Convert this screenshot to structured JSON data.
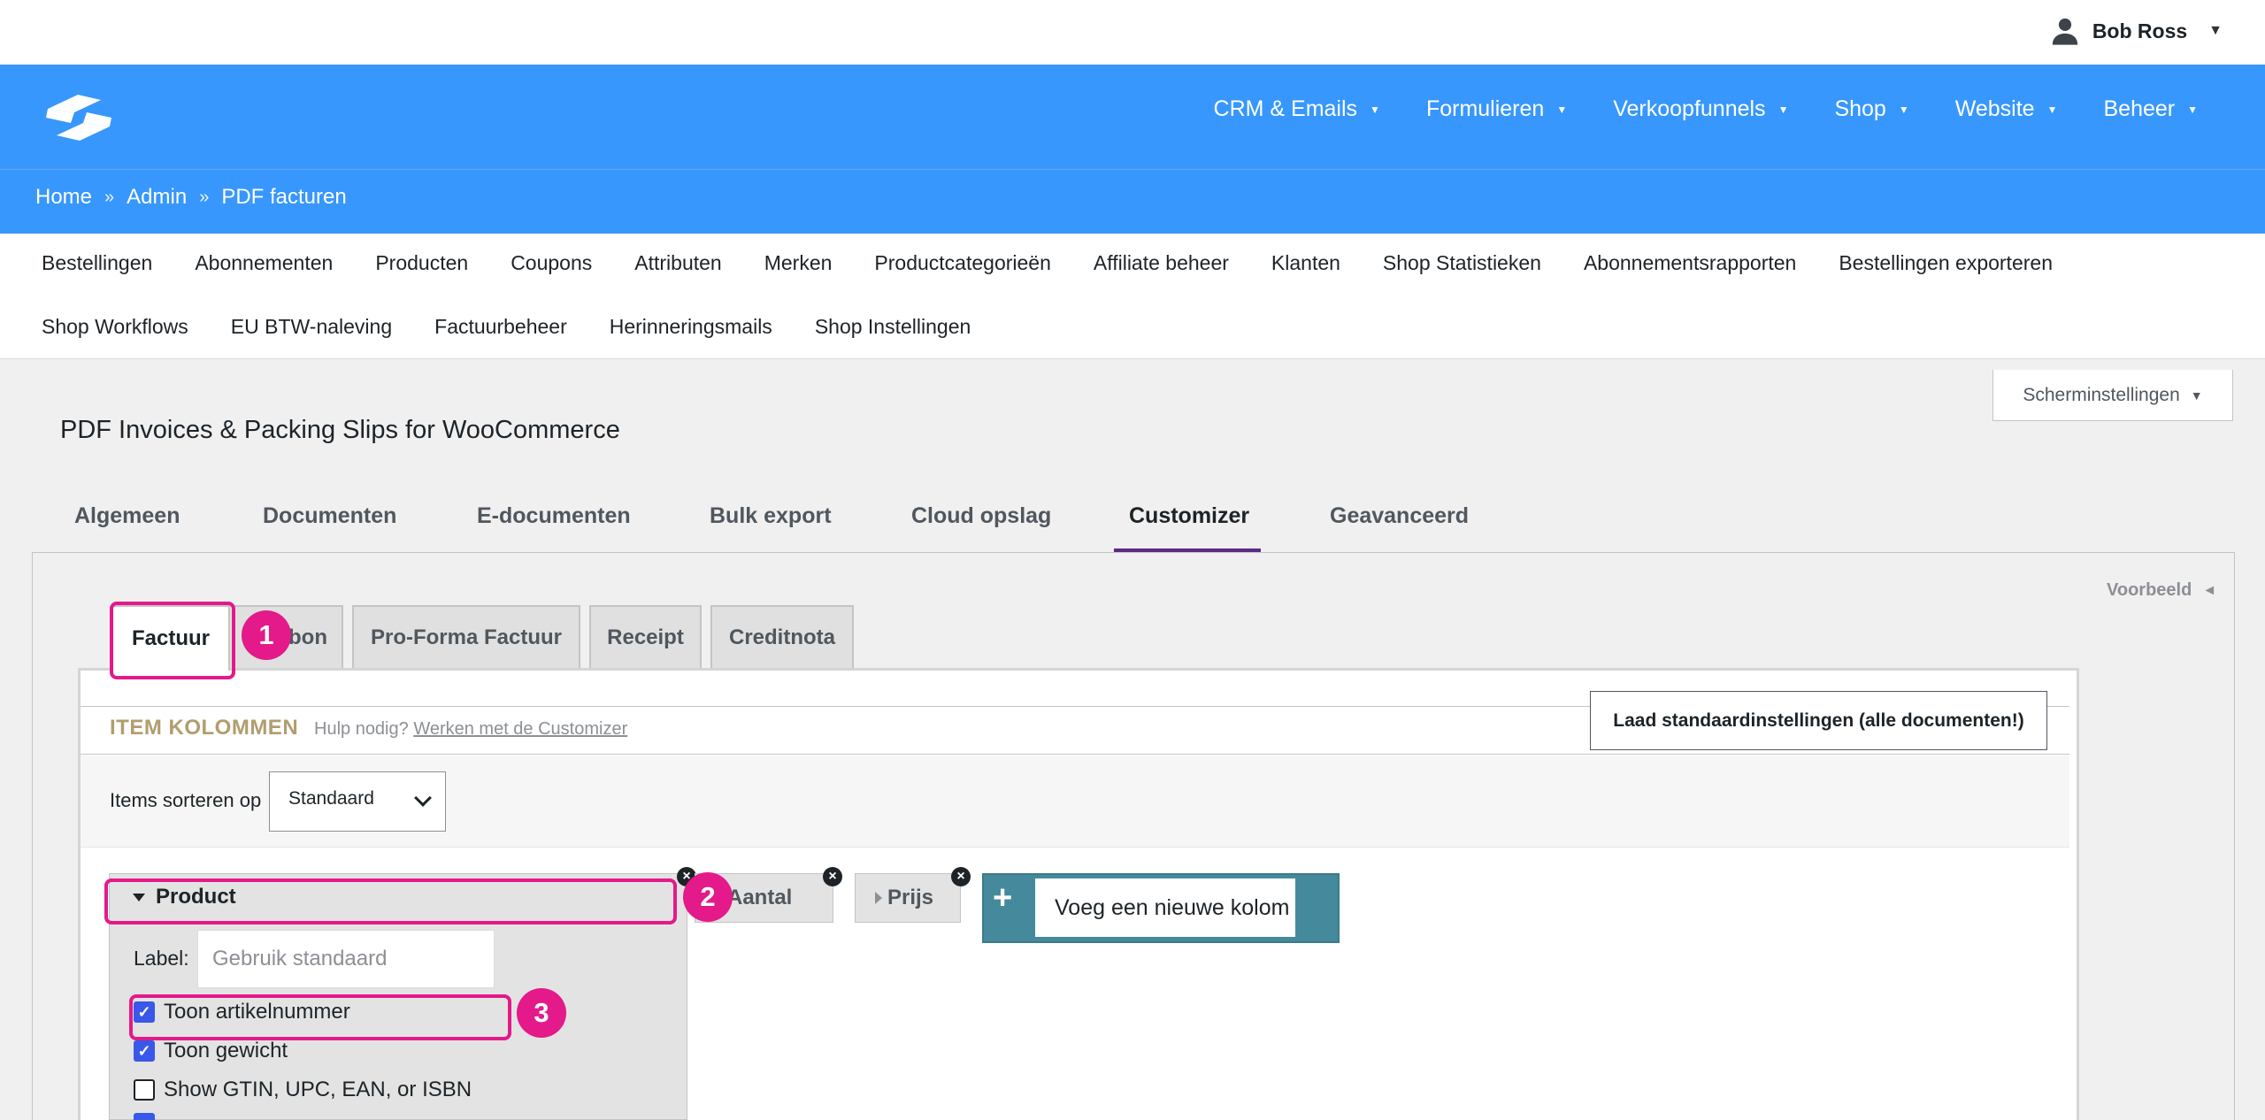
{
  "user": {
    "name": "Bob Ross",
    "icon": "user-icon"
  },
  "brand": {
    "logo": "brand-logo-icon",
    "color": "#3797fc"
  },
  "mainnav": [
    {
      "label": "CRM & Emails"
    },
    {
      "label": "Formulieren"
    },
    {
      "label": "Verkoopfunnels"
    },
    {
      "label": "Shop"
    },
    {
      "label": "Website"
    },
    {
      "label": "Beheer"
    }
  ],
  "breadcrumb": {
    "home": "Home",
    "sep": "»",
    "admin": "Admin",
    "current": "PDF facturen"
  },
  "subnav": {
    "row1": [
      "Bestellingen",
      "Abonnementen",
      "Producten",
      "Coupons",
      "Attributen",
      "Merken",
      "Productcategorieën",
      "Affiliate beheer",
      "Klanten",
      "Shop Statistieken",
      "Abonnementsrapporten",
      "Bestellingen exporteren"
    ],
    "row2": [
      "Shop Workflows",
      "EU BTW-naleving",
      "Factuurbeheer",
      "Herinneringsmails",
      "Shop Instellingen"
    ]
  },
  "screen_settings": {
    "label": "Scherminstellingen",
    "arrow": "▼"
  },
  "page_title": "PDF Invoices & Packing Slips for WooCommerce",
  "tabs": [
    "Algemeen",
    "Documenten",
    "E-documenten",
    "Bulk export",
    "Cloud opslag",
    "Customizer",
    "Geavanceerd"
  ],
  "active_tab": "Customizer",
  "preview": {
    "label": "Voorbeeld",
    "arrow": "◄"
  },
  "doc_tabs": [
    "Factuur",
    "Pakbon",
    "Pro-Forma Factuur",
    "Receipt",
    "Creditnota"
  ],
  "doc_tab_partial": "bon",
  "items": {
    "title": "ITEM KOLOMMEN",
    "help_text": "Hulp nodig?",
    "help_link": "Werken met de Customizer",
    "load_defaults": "Laad standaardinstellingen (alle documenten!)",
    "sort_label": "Items sorteren op",
    "sort_value": "Standaard"
  },
  "columns": {
    "product": "Product",
    "aantal": "Aantal",
    "prijs": "Prijs",
    "close": "×",
    "add_plus": "+",
    "add_placeholder": "Voeg een nieuwe kolom toe"
  },
  "product_settings": {
    "label_text": "Label:",
    "label_placeholder": "Gebruik standaard",
    "options": [
      {
        "label": "Toon artikelnummer",
        "checked": true
      },
      {
        "label": "Toon gewicht",
        "checked": true
      },
      {
        "label": "Show GTIN, UPC, EAN, or ISBN",
        "checked": false
      }
    ]
  },
  "annotations": [
    "1",
    "2",
    "3"
  ],
  "highlight_color": "#e4198a"
}
